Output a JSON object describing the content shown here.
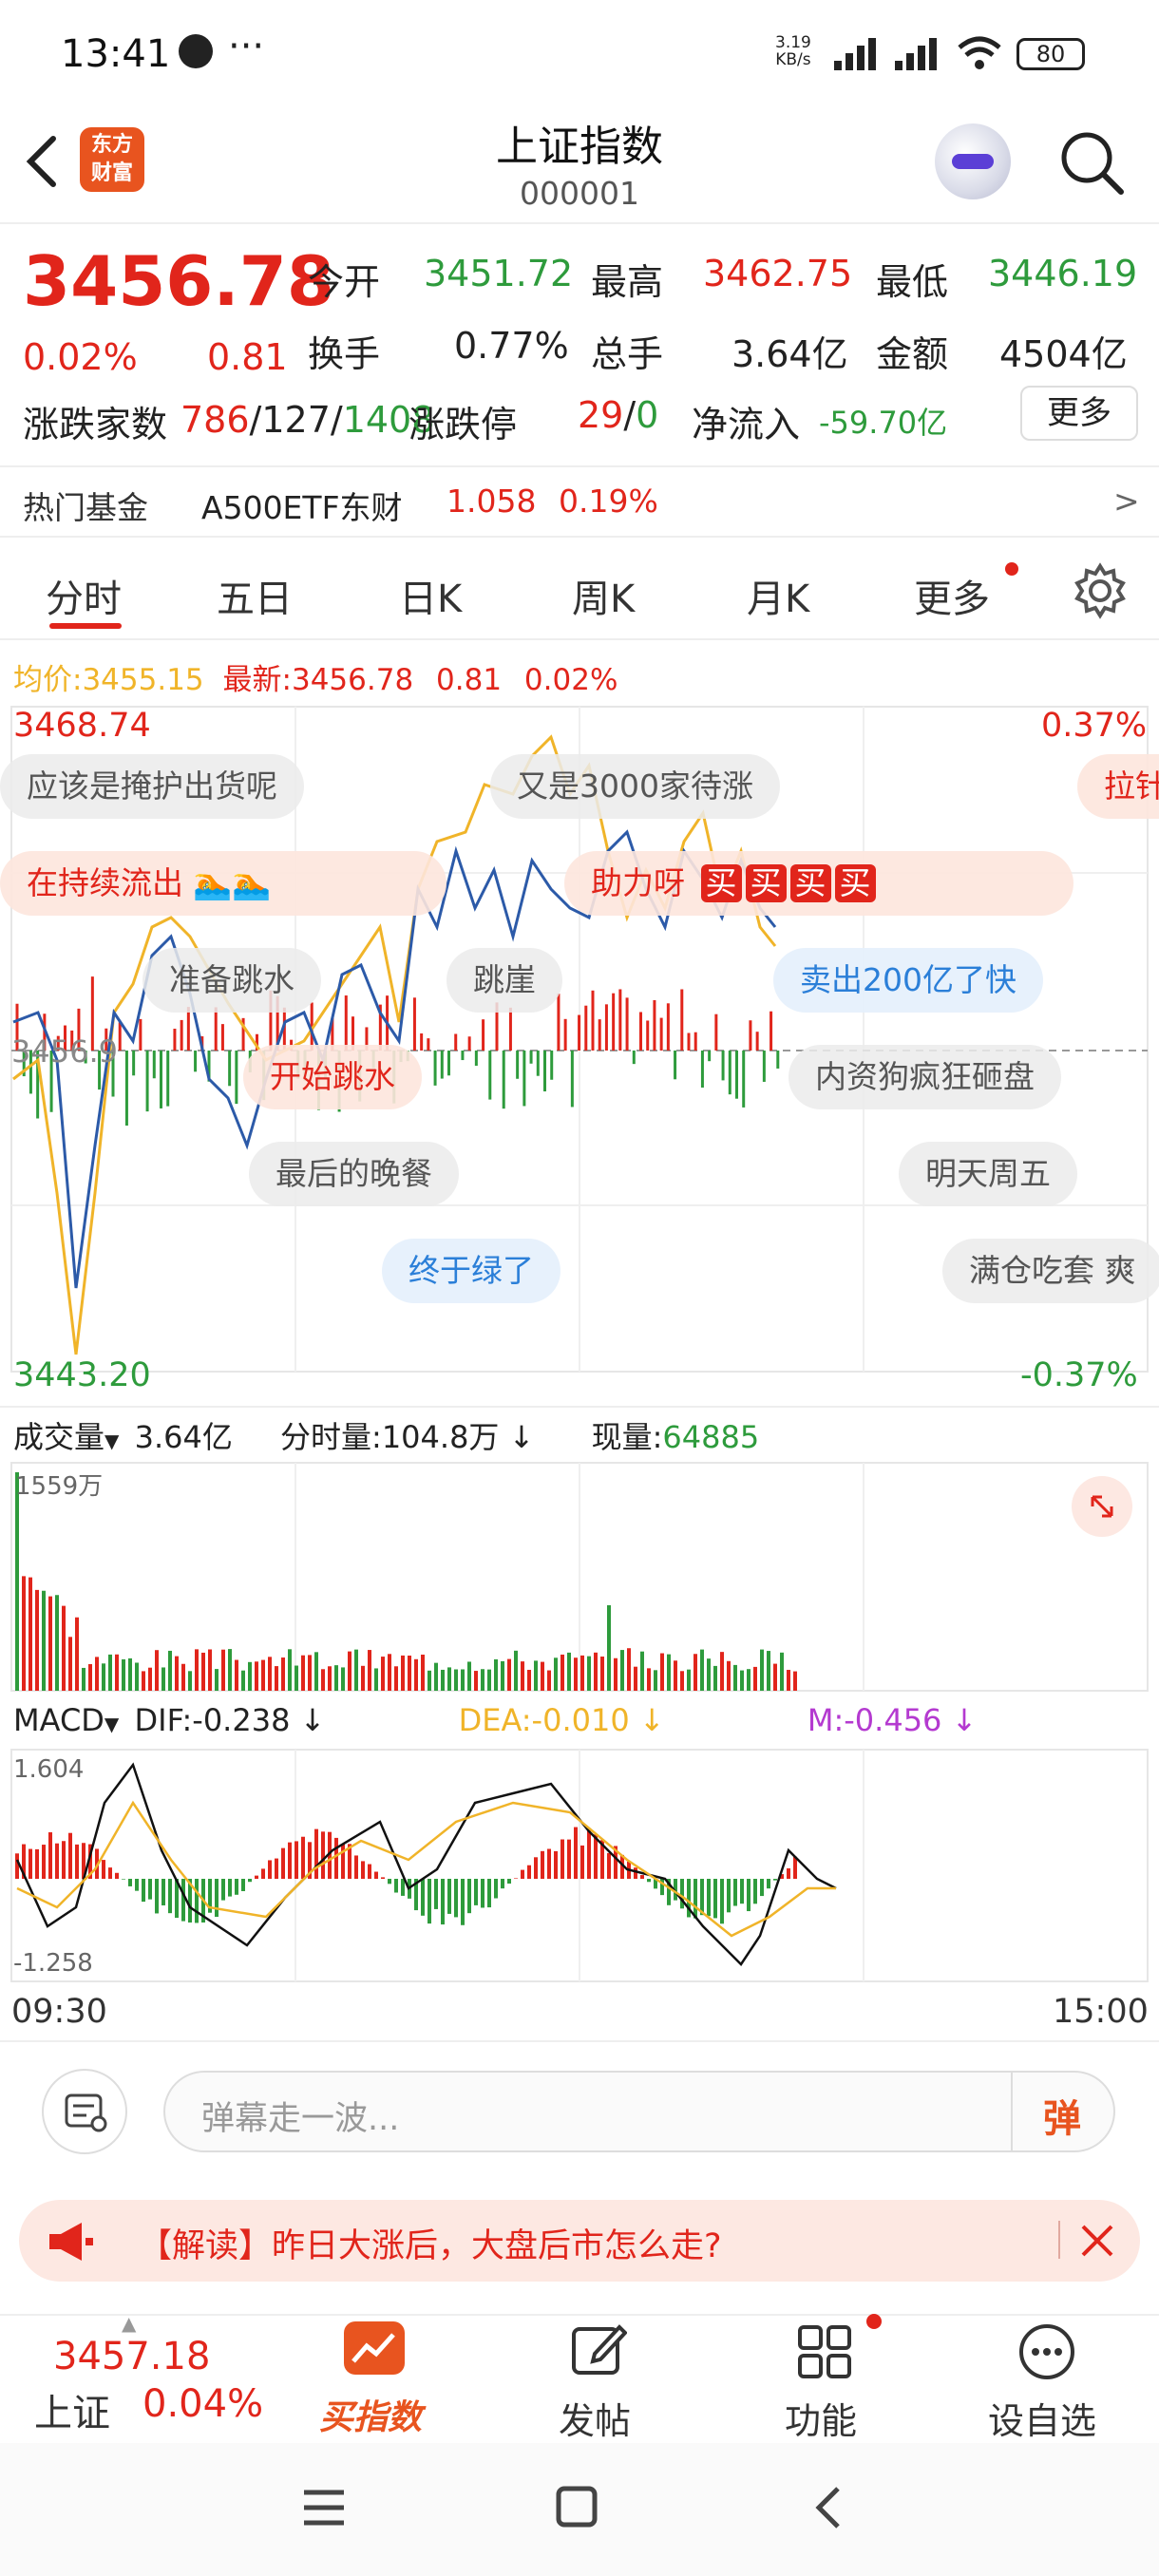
{
  "status_bar": {
    "time": "13:41",
    "speed_top": "3.19",
    "speed_bottom": "KB/s",
    "battery": "80"
  },
  "header": {
    "logo_line1": "东方",
    "logo_line2": "财富",
    "title": "上证指数",
    "code": "000001"
  },
  "quote": {
    "price": "3456.78",
    "change_pct": "0.02%",
    "change": "0.81",
    "open_label": "今开",
    "open": "3451.72",
    "high_label": "最高",
    "high": "3462.75",
    "low_label": "最低",
    "low": "3446.19",
    "turnover_label": "换手",
    "turnover": "0.77%",
    "volume_label": "总手",
    "volume": "3.64亿",
    "amount_label": "金额",
    "amount": "4504亿",
    "breadth_label": "涨跌家数",
    "breadth_up": "786",
    "breadth_flat": "127",
    "breadth_down": "1408",
    "breadth_sep": "/",
    "limit_label": "涨跌停",
    "limit_up": "29",
    "limit_down": "0",
    "limit_sep": "/",
    "netflow_label": "净流入",
    "netflow": "-59.70亿",
    "more_button": "更多"
  },
  "hot_fund": {
    "label": "热门基金",
    "name": "A500ETF东财",
    "price": "1.058",
    "pct": "0.19%",
    "arrow": ">"
  },
  "tabs": {
    "t0": "分时",
    "t1": "五日",
    "t2": "日K",
    "t3": "周K",
    "t4": "月K",
    "t5": "更多"
  },
  "intraday": {
    "avg_label": "均价:",
    "avg": "3455.15",
    "last_label": "最新:",
    "last": "3456.78",
    "chg": "0.81",
    "pct": "0.02%",
    "y_top": "3468.74",
    "y_top_pct": "0.37%",
    "y_mid": "3456.9",
    "y_bottom": "3443.20",
    "y_bottom_pct": "-0.37%"
  },
  "danmaku": {
    "d0": "应该是掩护出货呢",
    "d1": "又是3000家待涨",
    "d2": "拉针",
    "d3": "在持续流出",
    "d4": "助力呀",
    "d5": "买",
    "d6": "准备跳水",
    "d7": "跳崖",
    "d8": "卖出200亿了快",
    "d9": "开始跳水",
    "d10": "内资狗疯狂砸盘",
    "d11": "最后的晚餐",
    "d12": "明天周五",
    "d13": "终于绿了",
    "d14": "满仓吃套 爽"
  },
  "volume": {
    "label": "成交量",
    "total": "3.64亿",
    "minute_label": "分时量:",
    "minute": "104.8万",
    "now_label": "现量:",
    "now": "64885",
    "max": "1559万"
  },
  "macd": {
    "label": "MACD",
    "dif": "DIF:-0.238",
    "dea": "DEA:-0.010",
    "m": "M:-0.456",
    "max": "1.604",
    "min": "-1.258"
  },
  "time_axis": {
    "start": "09:30",
    "end": "15:00"
  },
  "comment": {
    "placeholder": "弹幕走一波...",
    "send": "弹"
  },
  "news": {
    "text": "【解读】昨日大涨后，大盘后市怎么走?"
  },
  "bottom_nav": {
    "index_price": "3457.18",
    "index_name": "上证",
    "index_pct": "0.04%",
    "buy": "买指数",
    "post": "发帖",
    "features": "功能",
    "watchlist": "设自选"
  },
  "colors": {
    "up": "#e1251b",
    "down": "#2e9b3c",
    "price_line": "#2c5aa8",
    "avg_line": "#f0b429",
    "macd_m": "#b43ad0"
  }
}
